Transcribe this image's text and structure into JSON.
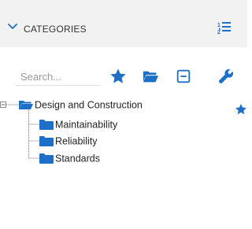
{
  "header": {
    "title": "CATEGORIES",
    "collapse_icon": "chevron-down-icon",
    "sort_icon": "sort-list-icon"
  },
  "toolbar": {
    "search_placeholder": "Search...",
    "search_value": "",
    "buttons": [
      {
        "name": "favorites-button",
        "icon": "star-icon"
      },
      {
        "name": "open-folder-button",
        "icon": "folder-open-icon"
      },
      {
        "name": "collapse-all-button",
        "icon": "minus-square-icon"
      },
      {
        "name": "settings-button",
        "icon": "wrench-icon"
      }
    ]
  },
  "tree": {
    "root": {
      "label": "Design and Construction",
      "expanded": true
    },
    "children": [
      {
        "label": "Maintainability"
      },
      {
        "label": "Reliability"
      },
      {
        "label": "Standards"
      }
    ]
  },
  "colors": {
    "accent": "#1e6fc6",
    "header_bg": "#f2f2f2",
    "text": "#2b2b2b"
  }
}
